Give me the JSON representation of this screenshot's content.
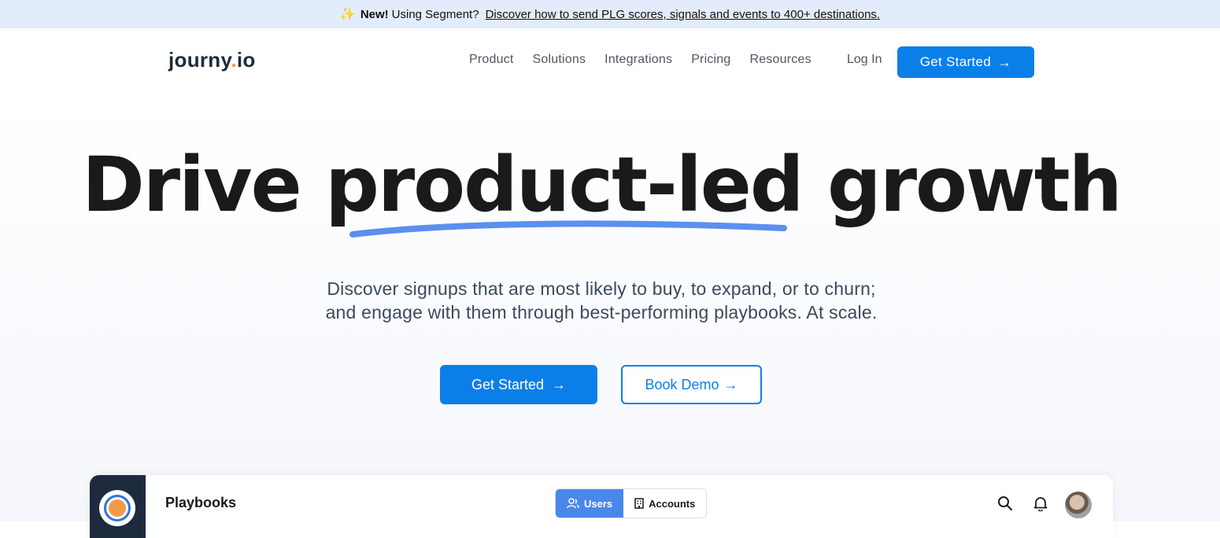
{
  "banner": {
    "new_label": "New!",
    "message": "Using Segment?",
    "link": "Discover how to send PLG scores, signals and events to 400+ destinations."
  },
  "nav": {
    "logo_main": "journy",
    "logo_dot": ".",
    "logo_tld": "io",
    "links": [
      "Product",
      "Solutions",
      "Integrations",
      "Pricing",
      "Resources"
    ],
    "login": "Log In",
    "cta": "Get Started"
  },
  "hero": {
    "title_start": "Drive ",
    "title_highlight": "product-led",
    "title_end": " growth",
    "subtitle_line1": "Discover signups that are most likely to buy, to expand, or to churn;",
    "subtitle_line2": "and engage with them through best-performing playbooks. At scale.",
    "primary_cta": "Get Started",
    "secondary_cta": "Book Demo"
  },
  "app_preview": {
    "title": "Playbooks",
    "toggle": [
      "Users",
      "Accounts"
    ]
  },
  "colors": {
    "accent": "#0b7fe8",
    "banner_bg": "#e3ecfa",
    "highlight_underline": "#5b8ff0",
    "logo_dot": "#f39a4a"
  }
}
